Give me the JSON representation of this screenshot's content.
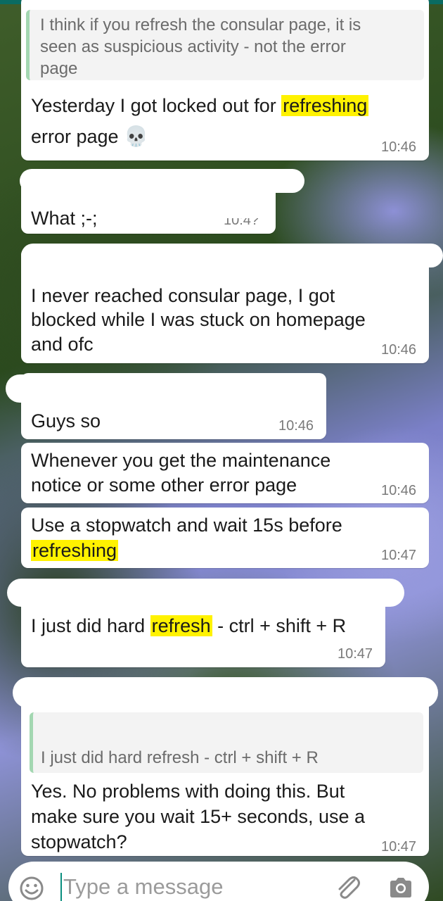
{
  "colors": {
    "accent": "#0a6b62",
    "highlight": "#fff200",
    "quote_bar": "#a3d7b1"
  },
  "messages": [
    {
      "quote": [
        "I think if you refresh the consular page, it is",
        "seen as suspicious activity - not the error",
        "page"
      ],
      "line1_before": "Yesterday I got locked out for ",
      "line1_highlight": "refreshing",
      "line2": "error page",
      "emoji": "💀",
      "time": "10:46"
    },
    {
      "text": "What ;-;",
      "time": "10:4?"
    },
    {
      "lines": [
        "I never reached consular page, I got",
        "blocked while I was stuck on homepage",
        "and ofc"
      ],
      "time": "10:46"
    },
    {
      "text": "Guys so",
      "time": "10:46"
    },
    {
      "lines": [
        "Whenever you get the maintenance",
        "notice or some other error page"
      ],
      "time": "10:46"
    },
    {
      "line1": "Use a stopwatch and wait 15s before",
      "line2_highlight": "refreshing",
      "time": "10:47"
    },
    {
      "before": "I just did hard ",
      "highlight": "refresh",
      "after": " - ctrl + shift + R",
      "time": "10:47"
    },
    {
      "quote": "I just did hard refresh - ctrl + shift + R",
      "lines": [
        "Yes. No problems with doing this. But",
        "make sure you wait 15+ seconds, use a",
        "stopwatch?"
      ],
      "time": "10:47"
    }
  ],
  "input": {
    "placeholder": "Type a message",
    "emoji_icon": "smiley-icon",
    "attach_icon": "paperclip-icon",
    "camera_icon": "camera-icon"
  }
}
